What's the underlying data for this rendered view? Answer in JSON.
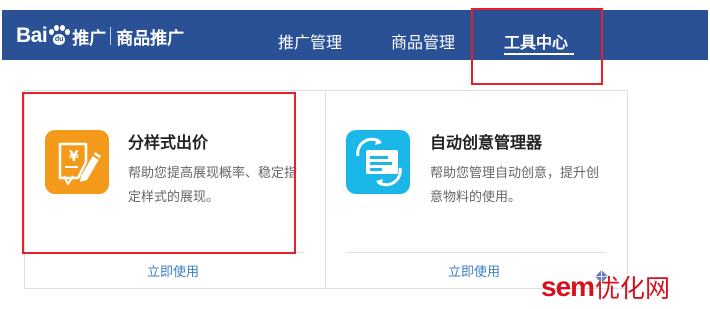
{
  "header": {
    "logo_bai": "Bai",
    "logo_du": "du",
    "logo_product": "推广",
    "logo_sub": "商品推广",
    "nav": [
      {
        "label": "推广管理",
        "active": false
      },
      {
        "label": "商品管理",
        "active": false
      },
      {
        "label": "工具中心",
        "active": true
      }
    ]
  },
  "cards": [
    {
      "title": "分样式出价",
      "desc_line1": "帮助您提高展现概率、稳定指",
      "desc_line2": "定样式的展现。",
      "link": "立即使用",
      "icon": "price-tag-pencil-icon"
    },
    {
      "title": "自动创意管理器",
      "desc_line1": "帮助您管理自动创意，提升创",
      "desc_line2": "意物料的使用。",
      "link": "立即使用",
      "icon": "refresh-card-icon"
    }
  ],
  "watermark": {
    "sem": "sem",
    "opt": "优化网"
  },
  "colors": {
    "header_bg": "#2a5195",
    "highlight": "#e8202b",
    "link": "#3a7fc4",
    "tile_orange": "#f39a1a",
    "tile_cyan": "#1ab7e8",
    "watermark": "#d6101c"
  }
}
